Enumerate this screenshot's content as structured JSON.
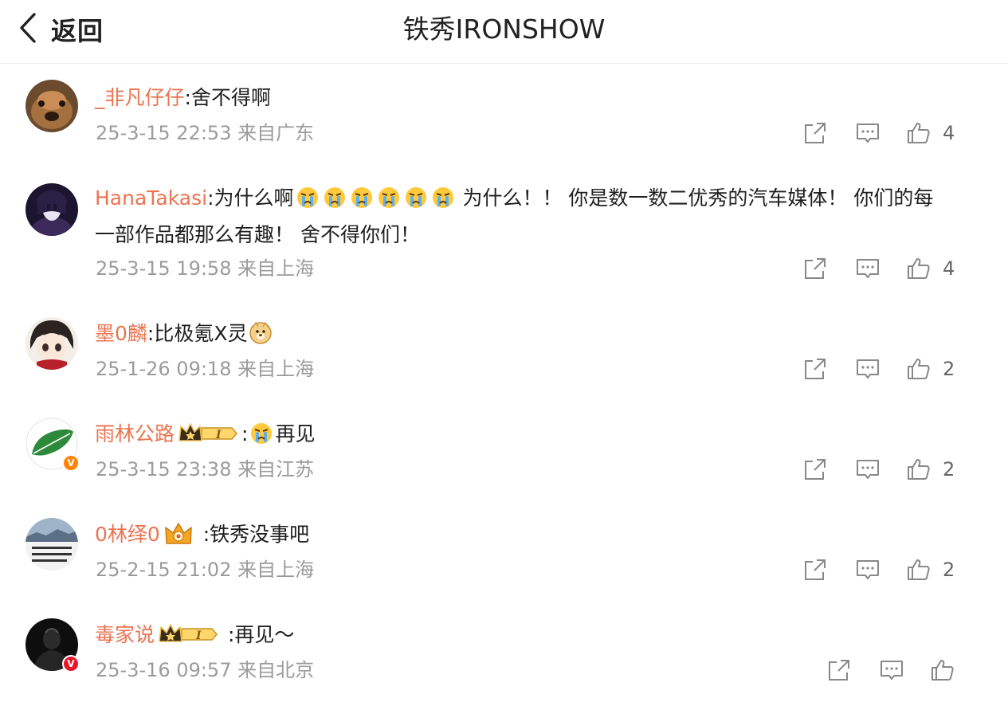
{
  "header": {
    "back_label": "返回",
    "title": "铁秀IRONSHOW"
  },
  "comments": [
    {
      "username": "_非凡仔仔",
      "text": ":舍不得啊",
      "time": "25-3-15 22:53",
      "location": "来自广东",
      "likes": "4"
    },
    {
      "username": "HanaTakasi",
      "text_a": ":为什么啊",
      "text_b": " 为什么！！ 你是数一数二优秀的汽车媒体！ 你们的每",
      "text_c": "一部作品都那么有趣！ 舍不得你们！",
      "time": "25-3-15 19:58",
      "location": "来自上海",
      "likes": "4"
    },
    {
      "username": "墨0麟",
      "text": ":比极氪X灵",
      "time": "25-1-26 09:18",
      "location": "来自上海",
      "likes": "2"
    },
    {
      "username": "雨林公路",
      "text_a": ":",
      "text_b": "再见",
      "time": "25-3-15 23:38",
      "location": "来自江苏",
      "likes": "2",
      "verified": "V"
    },
    {
      "username": "0林绎0",
      "text": " :铁秀没事吧",
      "time": "25-2-15 21:02",
      "location": "来自上海",
      "likes": "2"
    },
    {
      "username": "毒家说",
      "text": " :再见～",
      "time": "25-3-16 09:57",
      "location": "来自北京",
      "likes": "",
      "verified": "V"
    }
  ],
  "icons": {
    "share": "share-icon",
    "comment": "comment-icon",
    "like": "thumb-up-icon",
    "back": "chevron-left-icon"
  },
  "colors": {
    "username": "#eb7350",
    "meta": "#9b9b9b",
    "verified_orange": "#ff8200",
    "verified_red": "#e6162d"
  }
}
